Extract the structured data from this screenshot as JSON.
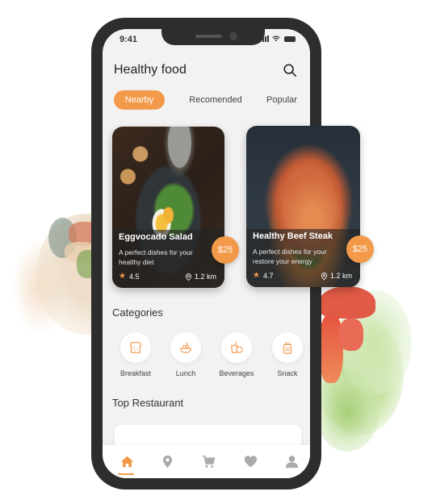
{
  "colors": {
    "accent": "#f2994a",
    "phone_frame": "#2d2d2d",
    "screen_bg": "#f2f2f2",
    "icon_inactive": "#aaaaaa",
    "text_dark": "#222222"
  },
  "status_bar": {
    "time": "9:41"
  },
  "header": {
    "title": "Healthy food",
    "search_icon": "search-icon"
  },
  "tabs": [
    {
      "label": "Nearby",
      "active": true
    },
    {
      "label": "Recomended",
      "active": false
    },
    {
      "label": "Popular",
      "active": false
    }
  ],
  "food_cards": [
    {
      "name": "Eggvocado Salad",
      "description": "A perfect dishes for your healthy diet",
      "rating": "4.5",
      "distance": "1.2 km",
      "price": "$25"
    },
    {
      "name": "Healthy Beef Steak",
      "description": "A perfect dishes for your restore your energy",
      "rating": "4.7",
      "distance": "1.2 km",
      "price": "$25"
    }
  ],
  "categories": {
    "title": "Categories",
    "items": [
      {
        "label": "Breakfast",
        "icon": "bread-icon"
      },
      {
        "label": "Lunch",
        "icon": "bowl-icon"
      },
      {
        "label": "Beverages",
        "icon": "drink-icon"
      },
      {
        "label": "Snack",
        "icon": "snack-jar-icon"
      }
    ]
  },
  "top_restaurant": {
    "title": "Top Restaurant"
  },
  "bottom_nav": {
    "items": [
      {
        "icon": "home-icon",
        "active": true
      },
      {
        "icon": "location-icon",
        "active": false
      },
      {
        "icon": "cart-icon",
        "active": false
      },
      {
        "icon": "heart-icon",
        "active": false
      },
      {
        "icon": "profile-icon",
        "active": false
      }
    ]
  }
}
